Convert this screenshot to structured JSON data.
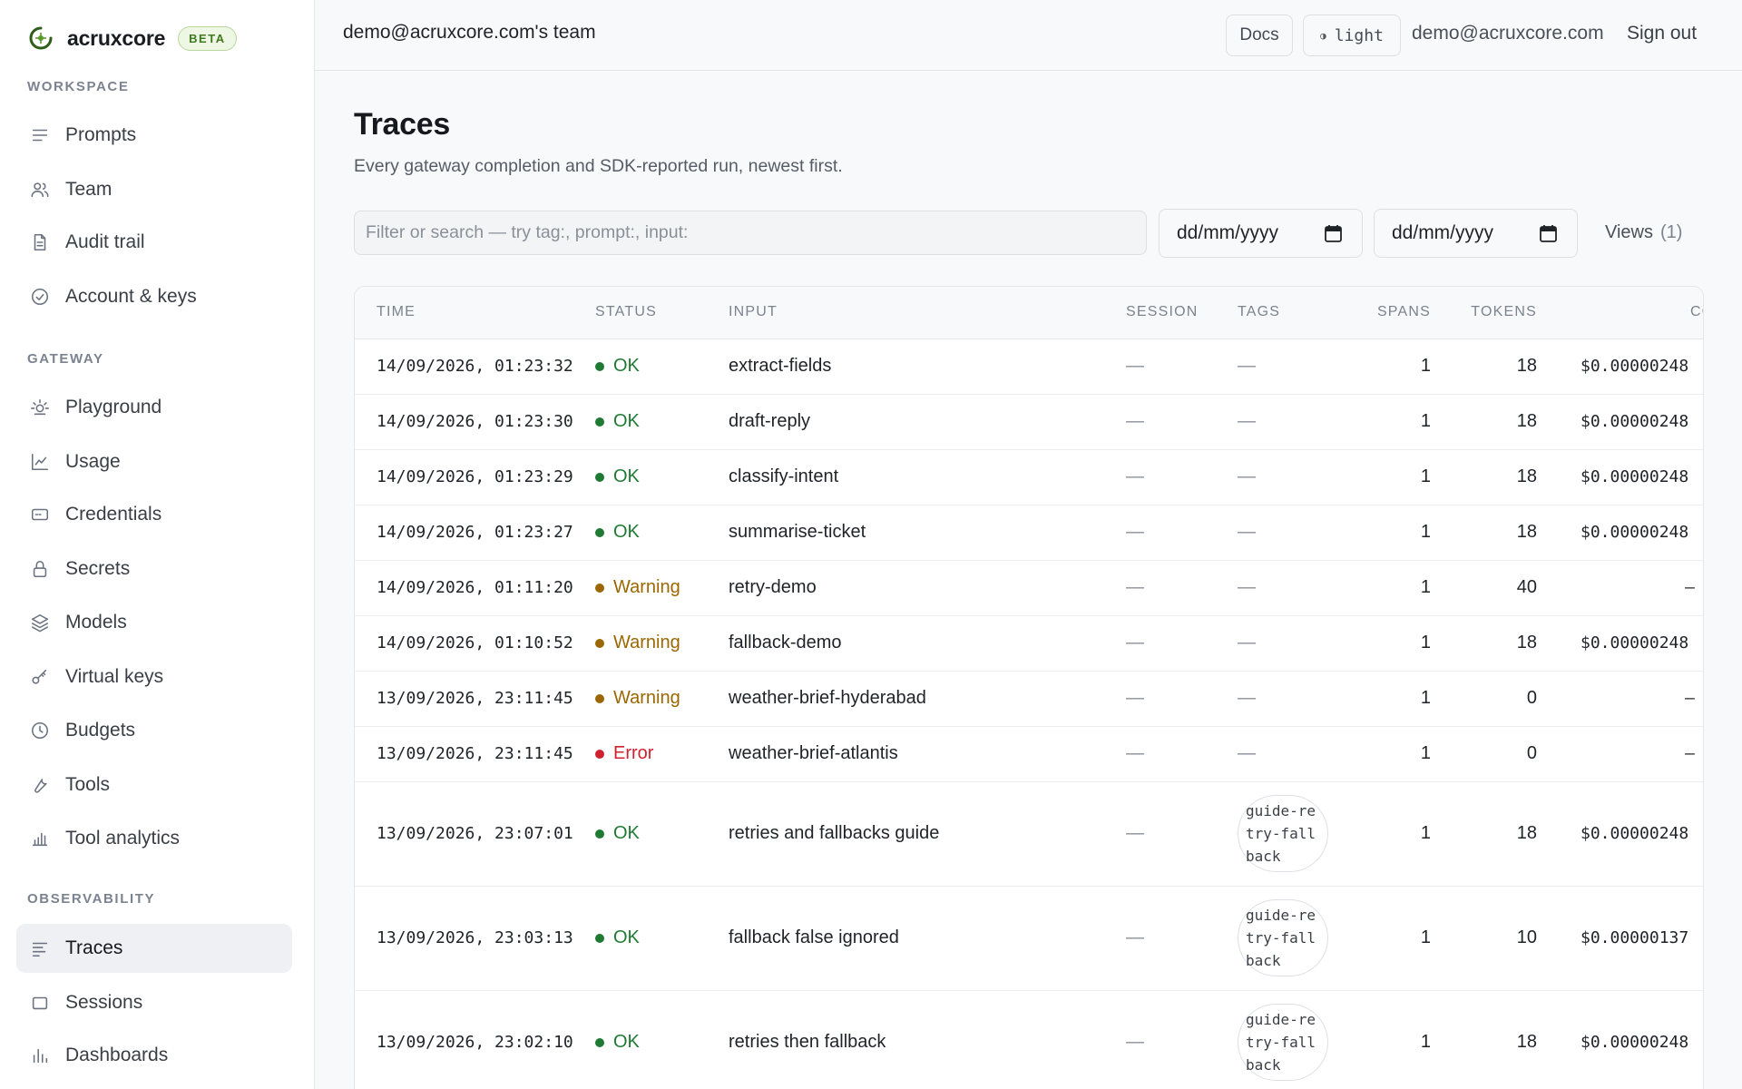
{
  "brand": {
    "name": "acruxcore",
    "badge": "BETA",
    "logo_icon": "acruxcore-logo-icon",
    "accent": "#3f7a1f"
  },
  "sidebar": {
    "sections": [
      {
        "label": "WORKSPACE",
        "items": [
          {
            "label": "Prompts",
            "icon": "list-icon"
          },
          {
            "label": "Team",
            "icon": "users-icon"
          },
          {
            "label": "Audit trail",
            "icon": "document-icon"
          },
          {
            "label": "Account & keys",
            "icon": "check-circle-icon"
          }
        ]
      },
      {
        "label": "GATEWAY",
        "items": [
          {
            "label": "Playground",
            "icon": "sun-icon"
          },
          {
            "label": "Usage",
            "icon": "line-chart-icon"
          },
          {
            "label": "Credentials",
            "icon": "card-icon"
          },
          {
            "label": "Secrets",
            "icon": "lock-icon"
          },
          {
            "label": "Models",
            "icon": "layers-icon"
          },
          {
            "label": "Virtual keys",
            "icon": "key-icon"
          },
          {
            "label": "Budgets",
            "icon": "clock-icon"
          },
          {
            "label": "Tools",
            "icon": "wrench-icon"
          },
          {
            "label": "Tool analytics",
            "icon": "bar-chart-icon"
          }
        ]
      },
      {
        "label": "OBSERVABILITY",
        "items": [
          {
            "label": "Traces",
            "icon": "traces-icon",
            "active": true
          },
          {
            "label": "Sessions",
            "icon": "square-icon"
          },
          {
            "label": "Dashboards",
            "icon": "bars-icon"
          }
        ]
      }
    ]
  },
  "topbar": {
    "team": "demo@acruxcore.com's team",
    "docs": "Docs",
    "theme": "light",
    "theme_icon": "half-circle-icon",
    "email": "demo@acruxcore.com",
    "signout": "Sign out"
  },
  "page": {
    "title": "Traces",
    "subtitle": "Every gateway completion and SDK-reported run, newest first."
  },
  "filters": {
    "search_placeholder": "Filter or search — try tag:, prompt:, input:",
    "search_value": "",
    "date_from": "dd/mm/yyyy",
    "date_to": "dd/mm/yyyy",
    "views_label": "Views",
    "views_count": "(1)"
  },
  "table": {
    "columns": [
      "TIME",
      "STATUS",
      "INPUT",
      "SESSION",
      "TAGS",
      "SPANS",
      "TOKENS",
      "COST"
    ],
    "rows": [
      {
        "time": "14/09/2026, 01:23:32",
        "status": "OK",
        "status_kind": "ok",
        "input": "extract-fields",
        "session": "—",
        "tags": "—",
        "spans": "1",
        "tokens": "18",
        "cost": "$0.00000248"
      },
      {
        "time": "14/09/2026, 01:23:30",
        "status": "OK",
        "status_kind": "ok",
        "input": "draft-reply",
        "session": "—",
        "tags": "—",
        "spans": "1",
        "tokens": "18",
        "cost": "$0.00000248"
      },
      {
        "time": "14/09/2026, 01:23:29",
        "status": "OK",
        "status_kind": "ok",
        "input": "classify-intent",
        "session": "—",
        "tags": "—",
        "spans": "1",
        "tokens": "18",
        "cost": "$0.00000248"
      },
      {
        "time": "14/09/2026, 01:23:27",
        "status": "OK",
        "status_kind": "ok",
        "input": "summarise-ticket",
        "session": "—",
        "tags": "—",
        "spans": "1",
        "tokens": "18",
        "cost": "$0.00000248"
      },
      {
        "time": "14/09/2026, 01:11:20",
        "status": "Warning",
        "status_kind": "warn",
        "input": "retry-demo",
        "session": "—",
        "tags": "—",
        "spans": "1",
        "tokens": "40",
        "cost": "—"
      },
      {
        "time": "14/09/2026, 01:10:52",
        "status": "Warning",
        "status_kind": "warn",
        "input": "fallback-demo",
        "session": "—",
        "tags": "—",
        "spans": "1",
        "tokens": "18",
        "cost": "$0.00000248"
      },
      {
        "time": "13/09/2026, 23:11:45",
        "status": "Warning",
        "status_kind": "warn",
        "input": "weather-brief-hyderabad",
        "session": "—",
        "tags": "—",
        "spans": "1",
        "tokens": "0",
        "cost": "—"
      },
      {
        "time": "13/09/2026, 23:11:45",
        "status": "Error",
        "status_kind": "err",
        "input": "weather-brief-atlantis",
        "session": "—",
        "tags": "—",
        "spans": "1",
        "tokens": "0",
        "cost": "—"
      },
      {
        "time": "13/09/2026, 23:07:01",
        "status": "OK",
        "status_kind": "ok",
        "input": "retries and fallbacks guide",
        "session": "—",
        "tags": "guide-retry-fallback",
        "spans": "1",
        "tokens": "18",
        "cost": "$0.00000248"
      },
      {
        "time": "13/09/2026, 23:03:13",
        "status": "OK",
        "status_kind": "ok",
        "input": "fallback false ignored",
        "session": "—",
        "tags": "guide-retry-fallback",
        "spans": "1",
        "tokens": "10",
        "cost": "$0.00000137"
      },
      {
        "time": "13/09/2026, 23:02:10",
        "status": "OK",
        "status_kind": "ok",
        "input": "retries then fallback",
        "session": "—",
        "tags": "guide-retry-fallback",
        "spans": "1",
        "tokens": "18",
        "cost": "$0.00000248"
      }
    ]
  },
  "colors": {
    "ok": "#1f7a34",
    "warning": "#9a6700",
    "error": "#cf222e"
  }
}
